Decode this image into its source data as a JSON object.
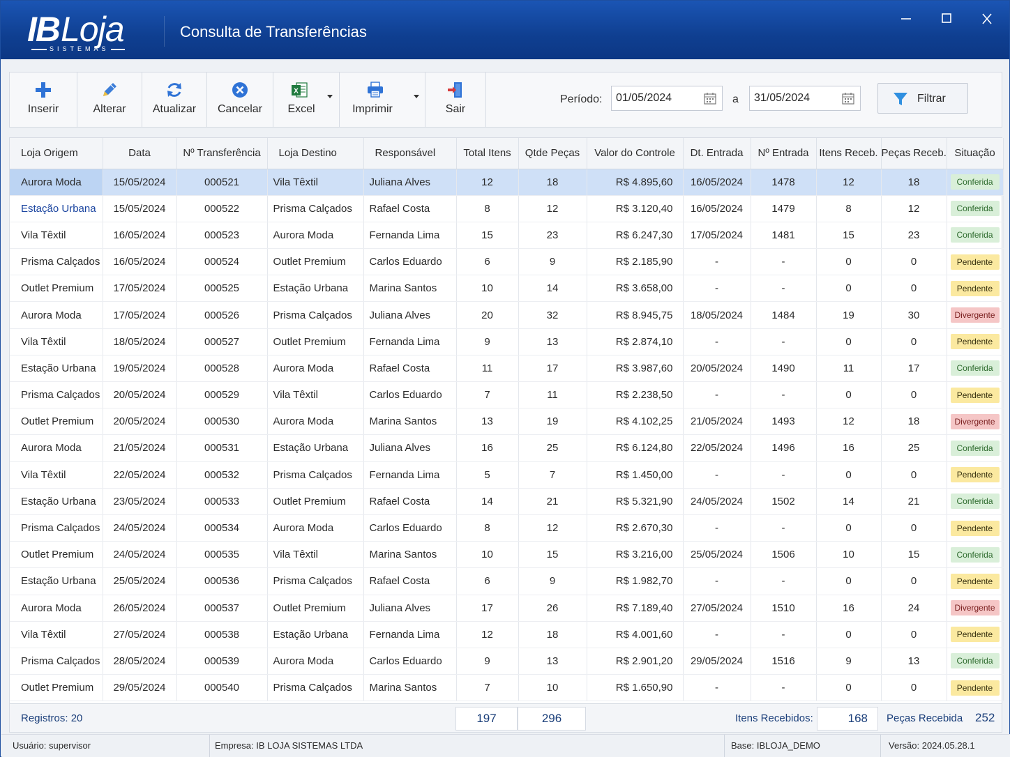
{
  "app": {
    "logo_main": "IB",
    "logo_loja": "Loja",
    "logo_sub": "SISTEMAS",
    "title": "Consulta de Transferências"
  },
  "window_controls": {
    "minimize": "—",
    "maximize": "☐",
    "close": "✕"
  },
  "toolbar": {
    "inserir": "Inserir",
    "alterar": "Alterar",
    "atualizar": "Atualizar",
    "cancelar": "Cancelar",
    "excel": "Excel",
    "imprimir": "Imprimir",
    "sair": "Sair",
    "periodo_label": "Período:",
    "date_from": "01/05/2024",
    "date_sep": "a",
    "date_to": "31/05/2024",
    "filtrar": "Filtrar"
  },
  "colors": {
    "title_bar": "#1b55b4",
    "accent": "#1b45a0",
    "conferida": "#d9efd9",
    "pendente": "#fbe9a0",
    "divergente": "#f5c6c6",
    "selected_row": "#cfe0f7"
  },
  "icons": {
    "inserir": "plus-icon",
    "alterar": "pencil-icon",
    "atualizar": "refresh-icon",
    "cancelar": "cancel-circle-icon",
    "excel": "excel-icon",
    "imprimir": "printer-icon",
    "sair": "exit-door-icon",
    "calendar": "calendar-icon",
    "filtrar": "funnel-icon"
  },
  "table": {
    "columns": [
      "Loja Origem",
      "Data",
      "Nº Transferência",
      "Loja Destino",
      "Responsável",
      "Total Itens",
      "Qtde Peças",
      "Valor do Controle",
      "Dt. Entrada",
      "Nº Entrada",
      "Itens Receb.",
      "Peças Receb.",
      "Situação"
    ],
    "selected_index": 0,
    "rows": [
      [
        "Aurora Moda",
        "15/05/2024",
        "000521",
        "Vila Têxtil",
        "Juliana Alves",
        "12",
        "18",
        "R$ 4.895,60",
        "16/05/2024",
        "1478",
        "12",
        "18",
        "Conferida"
      ],
      [
        "Estação Urbana",
        "15/05/2024",
        "000522",
        "Prisma Calçados",
        "Rafael Costa",
        "8",
        "12",
        "R$ 3.120,40",
        "16/05/2024",
        "1479",
        "8",
        "12",
        "Conferida"
      ],
      [
        "Vila Têxtil",
        "16/05/2024",
        "000523",
        "Aurora Moda",
        "Fernanda Lima",
        "15",
        "23",
        "R$ 6.247,30",
        "17/05/2024",
        "1481",
        "15",
        "23",
        "Conferida"
      ],
      [
        "Prisma Calçados",
        "16/05/2024",
        "000524",
        "Outlet Premium",
        "Carlos Eduardo",
        "6",
        "9",
        "R$ 2.185,90",
        "-",
        "-",
        "0",
        "0",
        "Pendente"
      ],
      [
        "Outlet Premium",
        "17/05/2024",
        "000525",
        "Estação Urbana",
        "Marina Santos",
        "10",
        "14",
        "R$ 3.658,00",
        "-",
        "-",
        "0",
        "0",
        "Pendente"
      ],
      [
        "Aurora Moda",
        "17/05/2024",
        "000526",
        "Prisma Calçados",
        "Juliana Alves",
        "20",
        "32",
        "R$ 8.945,75",
        "18/05/2024",
        "1484",
        "19",
        "30",
        "Divergente"
      ],
      [
        "Vila Têxtil",
        "18/05/2024",
        "000527",
        "Outlet Premium",
        "Fernanda Lima",
        "9",
        "13",
        "R$ 2.874,10",
        "-",
        "-",
        "0",
        "0",
        "Pendente"
      ],
      [
        "Estação Urbana",
        "19/05/2024",
        "000528",
        "Aurora Moda",
        "Rafael Costa",
        "11",
        "17",
        "R$ 3.987,60",
        "20/05/2024",
        "1490",
        "11",
        "17",
        "Conferida"
      ],
      [
        "Prisma Calçados",
        "20/05/2024",
        "000529",
        "Vila Têxtil",
        "Carlos Eduardo",
        "7",
        "11",
        "R$ 2.238,50",
        "-",
        "-",
        "0",
        "0",
        "Pendente"
      ],
      [
        "Outlet Premium",
        "20/05/2024",
        "000530",
        "Aurora Moda",
        "Marina Santos",
        "13",
        "19",
        "R$ 4.102,25",
        "21/05/2024",
        "1493",
        "12",
        "18",
        "Divergente"
      ],
      [
        "Aurora Moda",
        "21/05/2024",
        "000531",
        "Estação Urbana",
        "Juliana Alves",
        "16",
        "25",
        "R$ 6.124,80",
        "22/05/2024",
        "1496",
        "16",
        "25",
        "Conferida"
      ],
      [
        "Vila Têxtil",
        "22/05/2024",
        "000532",
        "Prisma Calçados",
        "Fernanda Lima",
        "5",
        "7",
        "R$ 1.450,00",
        "-",
        "-",
        "0",
        "0",
        "Pendente"
      ],
      [
        "Estação Urbana",
        "23/05/2024",
        "000533",
        "Outlet Premium",
        "Rafael Costa",
        "14",
        "21",
        "R$ 5.321,90",
        "24/05/2024",
        "1502",
        "14",
        "21",
        "Conferida"
      ],
      [
        "Prisma Calçados",
        "24/05/2024",
        "000534",
        "Aurora Moda",
        "Carlos Eduardo",
        "8",
        "12",
        "R$ 2.670,30",
        "-",
        "-",
        "0",
        "0",
        "Pendente"
      ],
      [
        "Outlet Premium",
        "24/05/2024",
        "000535",
        "Vila Têxtil",
        "Marina Santos",
        "10",
        "15",
        "R$ 3.216,00",
        "25/05/2024",
        "1506",
        "10",
        "15",
        "Conferida"
      ],
      [
        "Estação Urbana",
        "25/05/2024",
        "000536",
        "Prisma Calçados",
        "Rafael Costa",
        "6",
        "9",
        "R$ 1.982,70",
        "-",
        "-",
        "0",
        "0",
        "Pendente"
      ],
      [
        "Aurora Moda",
        "26/05/2024",
        "000537",
        "Outlet Premium",
        "Juliana Alves",
        "17",
        "26",
        "R$ 7.189,40",
        "27/05/2024",
        "1510",
        "16",
        "24",
        "Divergente"
      ],
      [
        "Vila Têxtil",
        "27/05/2024",
        "000538",
        "Estação Urbana",
        "Fernanda Lima",
        "12",
        "18",
        "R$ 4.001,60",
        "-",
        "-",
        "0",
        "0",
        "Pendente"
      ],
      [
        "Prisma Calçados",
        "28/05/2024",
        "000539",
        "Aurora Moda",
        "Carlos Eduardo",
        "9",
        "13",
        "R$ 2.901,20",
        "29/05/2024",
        "1516",
        "9",
        "13",
        "Conferida"
      ],
      [
        "Outlet Premium",
        "29/05/2024",
        "000540",
        "Prisma Calçados",
        "Marina Santos",
        "7",
        "10",
        "R$ 1.650,90",
        "-",
        "-",
        "0",
        "0",
        "Pendente"
      ]
    ]
  },
  "footer": {
    "registros_label": "Registros:",
    "registros_value": "20",
    "total_itens": "197",
    "total_pecas": "296",
    "itens_recebidos_label": "Itens Recebidos:",
    "itens_recebidos_value": "168",
    "pecas_recebidas_label": "Peças Recebidas:",
    "pecas_recebidas_value": "252"
  },
  "statusbar": {
    "usuario_label": "Usuário:",
    "usuario": "supervisor",
    "empresa_label": "Empresa:",
    "empresa": "IB LOJA SISTEMAS LTDA",
    "base_label": "Base:",
    "base": "IBLOJA_DEMO",
    "versao_label": "Versão:",
    "versao": "2024.05.28.1"
  }
}
